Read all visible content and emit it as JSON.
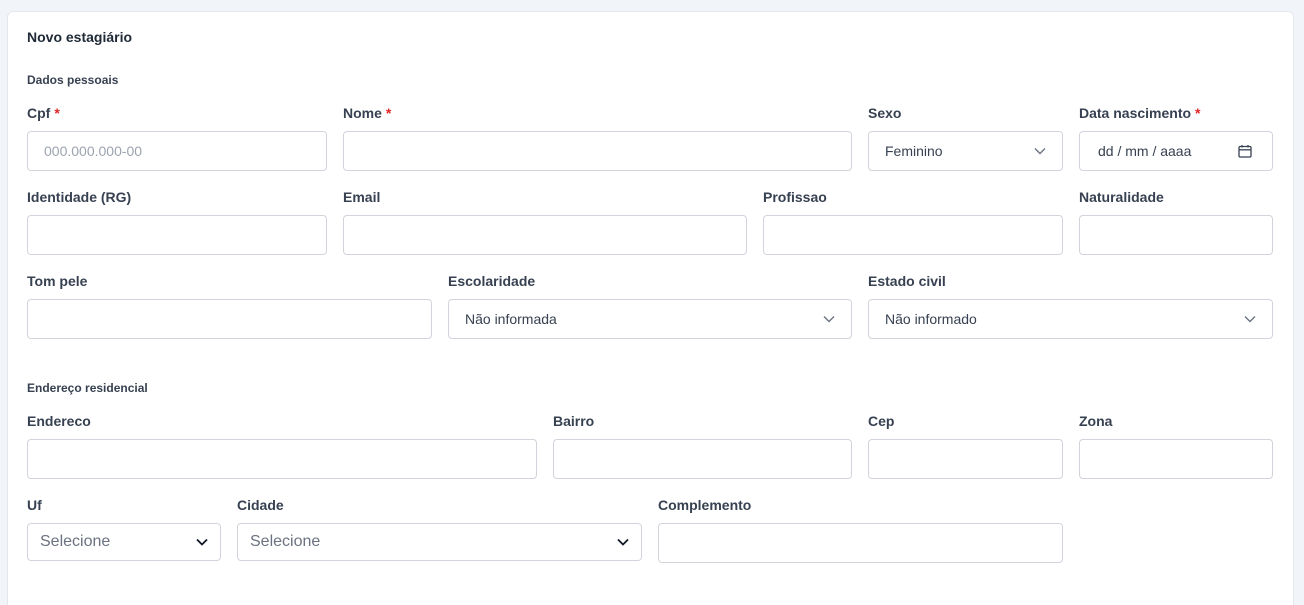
{
  "form": {
    "title": "Novo estagiário",
    "personal_section": "Dados pessoais",
    "address_section": "Endereço residencial",
    "required_mark": "*"
  },
  "fields": {
    "cpf": {
      "label": "Cpf",
      "placeholder": "000.000.000-00",
      "value": ""
    },
    "nome": {
      "label": "Nome",
      "value": ""
    },
    "sexo": {
      "label": "Sexo",
      "value": "Feminino"
    },
    "nascimento": {
      "label": "Data nascimento",
      "placeholder": "dd / mm / aaaa"
    },
    "identidade": {
      "label": "Identidade (RG)",
      "value": ""
    },
    "email": {
      "label": "Email",
      "value": ""
    },
    "profissao": {
      "label": "Profissao",
      "value": ""
    },
    "naturalidade": {
      "label": "Naturalidade",
      "value": ""
    },
    "tom_pele": {
      "label": "Tom pele",
      "value": ""
    },
    "escolaridade": {
      "label": "Escolaridade",
      "value": "Não informada"
    },
    "estado_civil": {
      "label": "Estado civil",
      "value": "Não informado"
    },
    "endereco": {
      "label": "Endereco",
      "value": ""
    },
    "bairro": {
      "label": "Bairro",
      "value": ""
    },
    "cep": {
      "label": "Cep",
      "value": ""
    },
    "zona": {
      "label": "Zona",
      "value": ""
    },
    "uf": {
      "label": "Uf",
      "value": "Selecione"
    },
    "cidade": {
      "label": "Cidade",
      "value": "Selecione"
    },
    "complemento": {
      "label": "Complemento",
      "value": ""
    }
  },
  "icons": {
    "dropdown": "chevron-down-icon",
    "date": "calendar-icon"
  }
}
